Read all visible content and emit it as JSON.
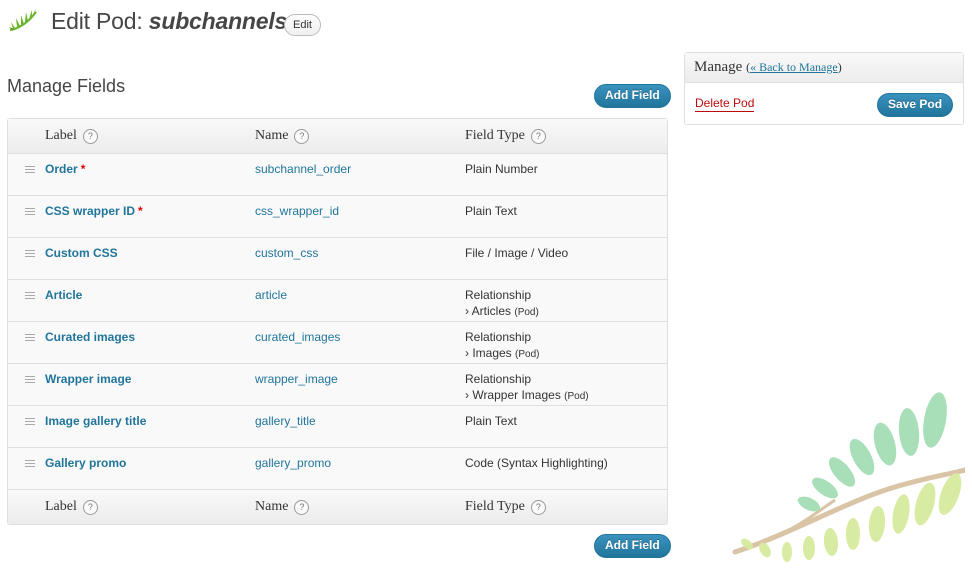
{
  "header": {
    "title_prefix": "Edit Pod:",
    "pod_name": "subchannels",
    "edit_label": "Edit"
  },
  "main": {
    "title": "Manage Fields",
    "add_field_label": "Add Field",
    "columns": {
      "label": "Label",
      "name": "Name",
      "type": "Field Type"
    },
    "help_glyph": "?",
    "fields": [
      {
        "label": "Order",
        "required": "*",
        "name": "subchannel_order",
        "type": "Plain Number",
        "related": "",
        "related_kind": ""
      },
      {
        "label": "CSS wrapper ID",
        "required": "*",
        "name": "css_wrapper_id",
        "type": "Plain Text",
        "related": "",
        "related_kind": ""
      },
      {
        "label": "Custom CSS",
        "required": "",
        "name": "custom_css",
        "type": "File / Image / Video",
        "related": "",
        "related_kind": ""
      },
      {
        "label": "Article",
        "required": "",
        "name": "article",
        "type": "Relationship",
        "related": "› Articles",
        "related_kind": "(Pod)"
      },
      {
        "label": "Curated images",
        "required": "",
        "name": "curated_images",
        "type": "Relationship",
        "related": "› Images",
        "related_kind": "(Pod)"
      },
      {
        "label": "Wrapper image",
        "required": "",
        "name": "wrapper_image",
        "type": "Relationship",
        "related": "› Wrapper Images",
        "related_kind": "(Pod)"
      },
      {
        "label": "Image gallery title",
        "required": "",
        "name": "gallery_title",
        "type": "Plain Text",
        "related": "",
        "related_kind": ""
      },
      {
        "label": "Gallery promo",
        "required": "",
        "name": "gallery_promo",
        "type": "Code (Syntax Highlighting)",
        "related": "",
        "related_kind": ""
      }
    ]
  },
  "manage": {
    "title": "Manage",
    "back_open": "(",
    "back_link": "« Back to Manage",
    "back_close": ")",
    "delete_label": "Delete Pod",
    "save_label": "Save Pod"
  },
  "colors": {
    "link": "#21759b",
    "button": "#21759b",
    "delete": "#bc0b0b",
    "required": "#dd0000"
  },
  "icons": {
    "logo": "pods-leaf-logo-icon",
    "help": "help-icon",
    "drag": "drag-handle-icon",
    "decoration": "leaf-branch-icon"
  }
}
